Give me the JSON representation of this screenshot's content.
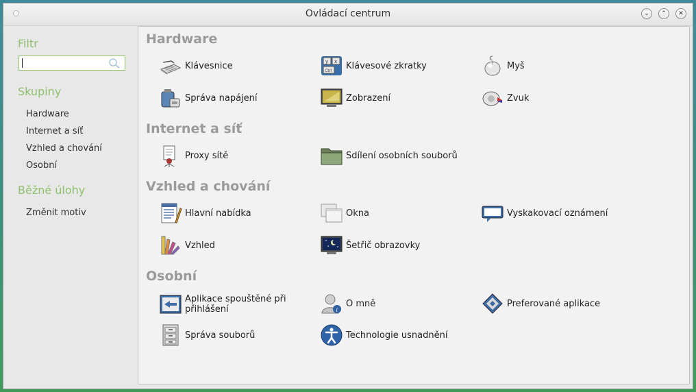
{
  "window": {
    "title": "Ovládací centrum"
  },
  "sidebar": {
    "filter_heading": "Filtr",
    "filter_value": "",
    "groups_heading": "Skupiny",
    "groups": [
      "Hardware",
      "Internet a síť",
      "Vzhled a chování",
      "Osobní"
    ],
    "tasks_heading": "Běžné úlohy",
    "tasks": [
      "Změnit motiv"
    ]
  },
  "sections": [
    {
      "title": "Hardware",
      "items": [
        {
          "label": "Klávesnice",
          "icon": "keyboard-icon"
        },
        {
          "label": "Klávesové zkratky",
          "icon": "keyboard-shortcuts-icon"
        },
        {
          "label": "Myš",
          "icon": "mouse-icon"
        },
        {
          "label": "Správa napájení",
          "icon": "power-management-icon"
        },
        {
          "label": "Zobrazení",
          "icon": "display-icon"
        },
        {
          "label": "Zvuk",
          "icon": "sound-icon"
        }
      ]
    },
    {
      "title": "Internet a síť",
      "items": [
        {
          "label": "Proxy sítě",
          "icon": "network-proxy-icon"
        },
        {
          "label": "Sdílení osobních souborů",
          "icon": "folder-share-icon"
        }
      ]
    },
    {
      "title": "Vzhled a chování",
      "items": [
        {
          "label": "Hlavní nabídka",
          "icon": "main-menu-icon"
        },
        {
          "label": "Okna",
          "icon": "windows-icon"
        },
        {
          "label": "Vyskakovací oznámení",
          "icon": "notification-icon"
        },
        {
          "label": "Vzhled",
          "icon": "appearance-icon"
        },
        {
          "label": "Šetřič obrazovky",
          "icon": "screensaver-icon"
        }
      ]
    },
    {
      "title": "Osobní",
      "items": [
        {
          "label": "Aplikace spouštěné při přihlášení",
          "icon": "startup-apps-icon"
        },
        {
          "label": "O mně",
          "icon": "about-me-icon"
        },
        {
          "label": "Preferované aplikace",
          "icon": "preferred-apps-icon"
        },
        {
          "label": "Správa souborů",
          "icon": "file-management-icon"
        },
        {
          "label": "Technologie usnadnění",
          "icon": "accessibility-icon"
        }
      ]
    }
  ]
}
